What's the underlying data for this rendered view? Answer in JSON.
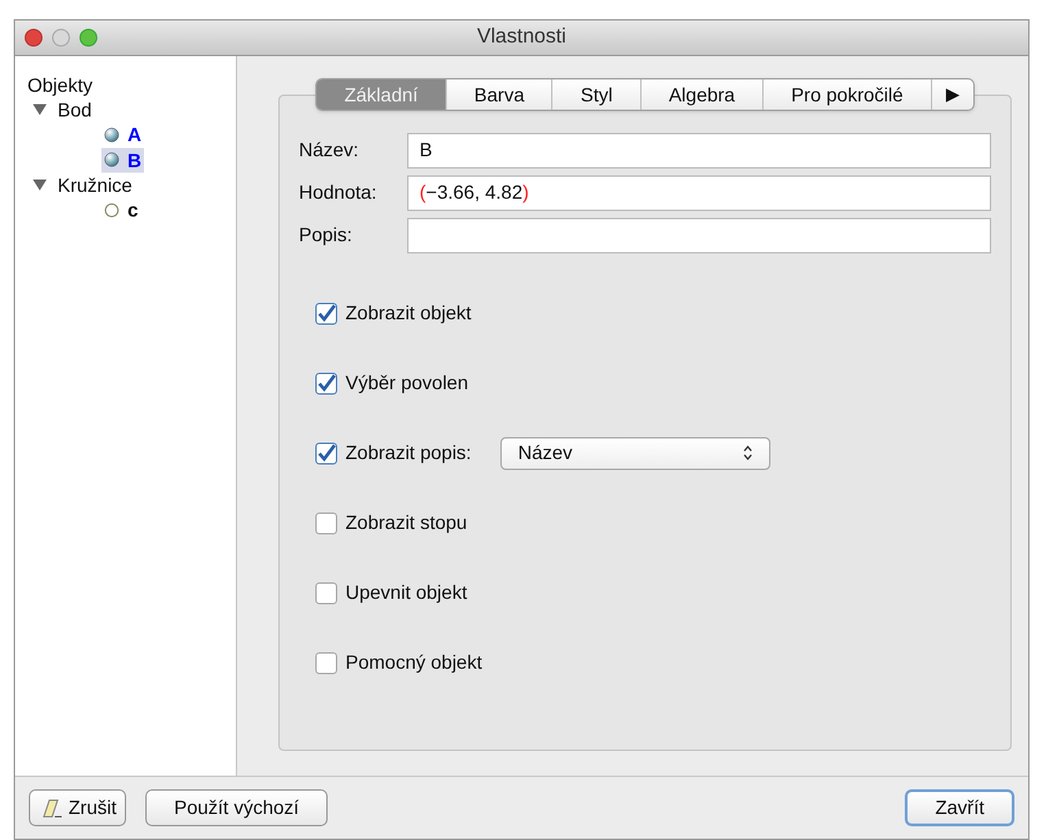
{
  "window": {
    "title": "Vlastnosti"
  },
  "tree": {
    "heading": "Objekty",
    "items": [
      {
        "label": "Bod",
        "expanded": true,
        "children": [
          {
            "label": "A",
            "kind": "point",
            "selected": false
          },
          {
            "label": "B",
            "kind": "point",
            "selected": true
          }
        ]
      },
      {
        "label": "Kružnice",
        "expanded": true,
        "children": [
          {
            "label": "c",
            "kind": "circle",
            "selected": false
          }
        ]
      }
    ]
  },
  "tabs": [
    {
      "label": "Základní",
      "selected": true
    },
    {
      "label": "Barva",
      "selected": false
    },
    {
      "label": "Styl",
      "selected": false
    },
    {
      "label": "Algebra",
      "selected": false
    },
    {
      "label": "Pro pokročilé",
      "selected": false
    }
  ],
  "tabs_more": "▶",
  "fields": [
    {
      "label": "Název:",
      "parts": [
        {
          "text": "B",
          "highlighted": false
        }
      ]
    },
    {
      "label": "Hodnota:",
      "parts": [
        {
          "text": "(",
          "highlighted": true
        },
        {
          "text": "−3.66, 4.82",
          "highlighted": false
        },
        {
          "text": ")",
          "highlighted": true
        }
      ]
    },
    {
      "label": "Popis:"
    }
  ],
  "options": [
    {
      "kind": "checkbox",
      "label": "Zobrazit objekt",
      "checked": true
    },
    {
      "kind": "checkbox",
      "label": "Výběr povolen",
      "checked": true
    },
    {
      "kind": "select",
      "label": "Zobrazit popis:",
      "checked": true,
      "value": "Název"
    },
    {
      "kind": "checkbox",
      "label": "Zobrazit stopu",
      "checked": false
    },
    {
      "kind": "checkbox",
      "label": "Upevnit objekt",
      "checked": false
    },
    {
      "kind": "checkbox",
      "label": "Pomocný objekt",
      "checked": false
    }
  ],
  "buttons": {
    "cancel": "Zrušit",
    "defaults": "Použít výchozí",
    "close": "Zavřít"
  }
}
